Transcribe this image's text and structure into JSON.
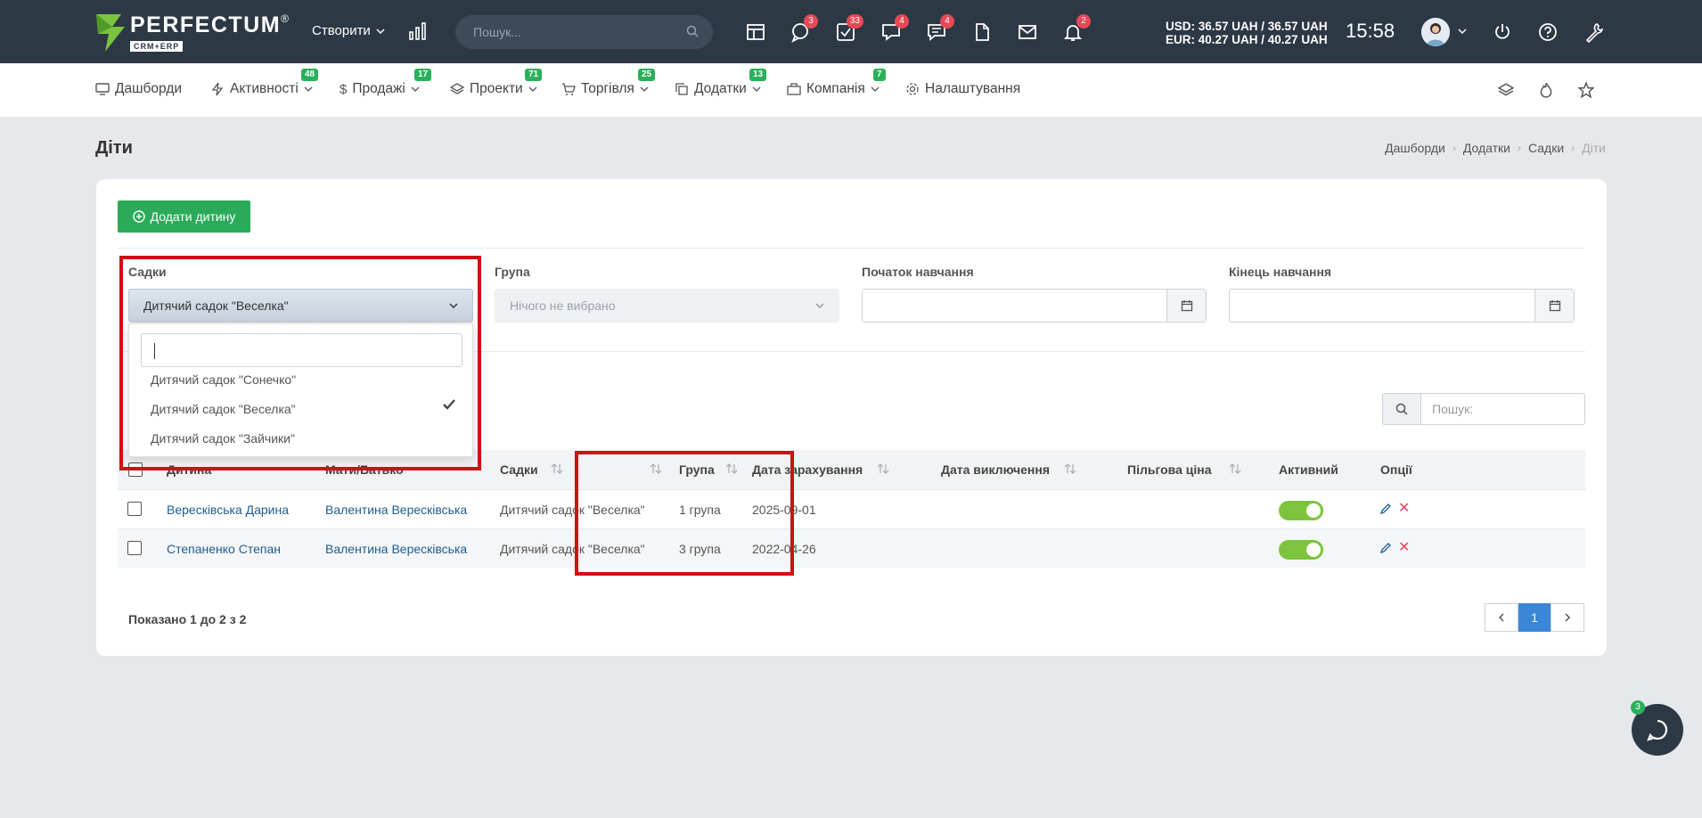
{
  "topbar": {
    "logo_word": "PERFECTUM",
    "logo_reg": "®",
    "logo_sub": "CRM+ERP",
    "create_label": "Створити",
    "search_placeholder": "Пошук...",
    "icons": [
      {
        "name": "layout-icon",
        "badge": ""
      },
      {
        "name": "chat-bubble-icon",
        "badge": "3"
      },
      {
        "name": "tasks-check-icon",
        "badge": "33"
      },
      {
        "name": "discussion-icon",
        "badge": "4"
      },
      {
        "name": "messages-icon",
        "badge": "4"
      },
      {
        "name": "document-icon",
        "badge": ""
      },
      {
        "name": "mail-icon",
        "badge": ""
      },
      {
        "name": "bell-icon",
        "badge": "2"
      }
    ],
    "currency_usd": "USD: 36.57 UAH / 36.57 UAH",
    "currency_eur": "EUR: 40.27 UAH / 40.27 UAH",
    "time": "15:58"
  },
  "nav": [
    {
      "label": "Дашборди",
      "badge": ""
    },
    {
      "label": "Активності",
      "badge": "48"
    },
    {
      "label": "Продажі",
      "badge": "17"
    },
    {
      "label": "Проекти",
      "badge": "71"
    },
    {
      "label": "Торгівля",
      "badge": "25"
    },
    {
      "label": "Додатки",
      "badge": "13"
    },
    {
      "label": "Компанія",
      "badge": "7"
    },
    {
      "label": "Налаштування",
      "badge": ""
    }
  ],
  "page": {
    "title": "Діти",
    "breadcrumb": [
      "Дашборди",
      "Додатки",
      "Садки",
      "Діти"
    ]
  },
  "card": {
    "add_button": "Додати дитину",
    "filters": {
      "sadky_label": "Садки",
      "sadky_value": "Дитячий садок \"Веселка\"",
      "grupa_label": "Група",
      "grupa_value": "Нічого не вибрано",
      "start_label": "Початок навчання",
      "end_label": "Кінець навчання"
    },
    "dropdown_options": [
      "Дитячий садок \"Сонечко\"",
      "Дитячий садок \"Веселка\"",
      "Дитячий садок \"Зайчики\""
    ],
    "table_search_placeholder": "Пошук:",
    "columns": [
      "Дитина",
      "Мати/Батько",
      "Садки",
      "Група",
      "Дата зарахування",
      "Дата виключення",
      "Пільгова ціна",
      "Активний",
      "Опції"
    ],
    "rows": [
      {
        "child": "Вересківська Дарина",
        "parent": "Валентина Вересківська",
        "garden": "Дитячий садок \"Веселка\"",
        "group": "1 група",
        "enrolled": "2025-09-01",
        "excluded": "",
        "discount": "",
        "active": true
      },
      {
        "child": "Степаненко Степан",
        "parent": "Валентина Вересківська",
        "garden": "Дитячий садок \"Веселка\"",
        "group": "3 група",
        "enrolled": "2022-04-26",
        "excluded": "",
        "discount": "",
        "active": true
      }
    ],
    "showing": "Показано 1 до 2 з 2",
    "current_page": "1"
  },
  "chat_badge": "3",
  "colors": {
    "topbar": "#2d3845",
    "accent_green": "#2bab5a",
    "badge_red": "#e84855",
    "highlight": "#d10e14"
  }
}
